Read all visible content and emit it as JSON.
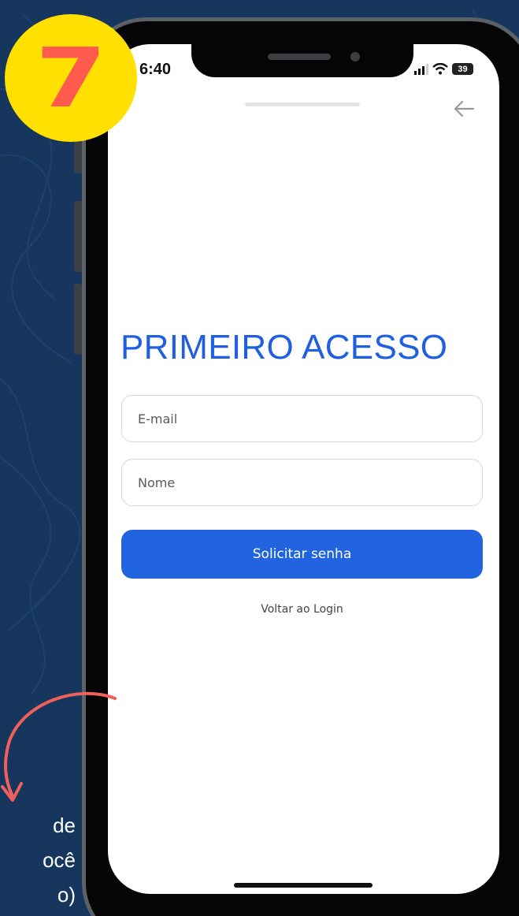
{
  "step_badge": {
    "number": "7"
  },
  "status_bar": {
    "time": "6:40",
    "battery": "39"
  },
  "screen": {
    "title": "PRIMEIRO ACESSO",
    "email_placeholder": "E-mail",
    "name_placeholder": "Nome",
    "submit_label": "Solicitar senha",
    "back_to_login": "Voltar ao Login"
  },
  "caption": {
    "lines": [
      "de",
      "ocê",
      "o)"
    ]
  },
  "icons": {
    "back": "arrow-left-icon",
    "signal": "signal-bars-icon",
    "wifi": "wifi-icon",
    "battery": "battery-icon",
    "annotation": "curved-arrow-icon"
  },
  "colors": {
    "background": "#16365e",
    "badge": "#ffe000",
    "badge_number": "#ff5a4e",
    "title": "#1f5fe0",
    "button": "#2263e0",
    "annotation_arrow": "#f0615c"
  }
}
